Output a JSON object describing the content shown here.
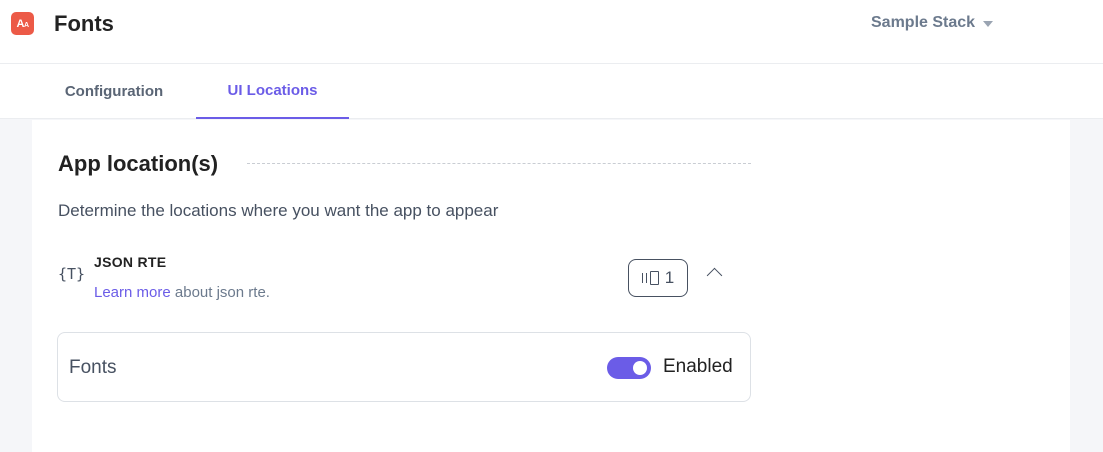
{
  "header": {
    "logo_text": "A",
    "logo_small": "A",
    "title": "Fonts",
    "stack_name": "Sample Stack"
  },
  "tabs": [
    {
      "label": "Configuration",
      "active": false
    },
    {
      "label": "UI Locations",
      "active": true
    }
  ],
  "main": {
    "section_title": "App location(s)",
    "description": "Determine the locations where you want the app to appear",
    "location": {
      "icon_glyph": "{T}",
      "name": "JSON RTE",
      "help_link": "Learn more",
      "help_text": " about json rte.",
      "count": "1",
      "expanded": true
    },
    "extension": {
      "name": "Fonts",
      "status_label": "Enabled",
      "enabled": true
    }
  },
  "colors": {
    "accent": "#6b5ce7",
    "logo": "#ec5a47",
    "background": "#f5f6f9"
  }
}
